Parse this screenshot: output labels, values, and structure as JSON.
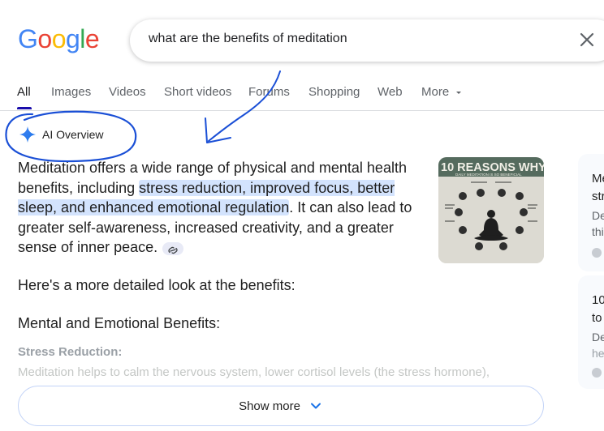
{
  "logo": {
    "letters": [
      "G",
      "o",
      "o",
      "g",
      "l",
      "e"
    ],
    "colors": [
      "#4285F4",
      "#EA4335",
      "#FBBC05",
      "#4285F4",
      "#34A853",
      "#EA4335"
    ]
  },
  "search": {
    "query": "what are the benefits of meditation",
    "clear_icon": "close-icon"
  },
  "tabs": [
    {
      "label": "All",
      "active": true
    },
    {
      "label": "Images"
    },
    {
      "label": "Videos"
    },
    {
      "label": "Short videos"
    },
    {
      "label": "Forums"
    },
    {
      "label": "Shopping"
    },
    {
      "label": "Web"
    },
    {
      "label": "More"
    }
  ],
  "ai_overview": {
    "label": "AI Overview",
    "icon": "sparkle-icon",
    "text_before": "Meditation offers a wide range of physical and mental health benefits, including ",
    "highlight": "stress reduction, improved focus, better sleep, and enhanced emotional regulation",
    "text_after": ". It can also lead to greater self-awareness, increased creativity, and a greater sense of inner peace.",
    "thumbnail_title": "10 REASONS WHY",
    "thumbnail_subtitle": "DAILY MEDITATION IS SO BENEFICIAL",
    "subhead1": "Here's a more detailed look at the benefits:",
    "subhead2": "Mental and Emotional Benefits:",
    "section_title": "Stress Reduction:",
    "section_text": "Meditation helps to calm the nervous system, lower cortisol levels (the stress hormone),",
    "show_more": "Show more"
  },
  "side_cards": [
    {
      "title1": "Me",
      "title2": "str",
      "snip1": "De",
      "snip2": "thi"
    },
    {
      "title1": "10",
      "title2": "to",
      "snip1": "De",
      "snip2": "he"
    }
  ],
  "colors": {
    "accent": "#1a0dab",
    "highlight": "#d3e3fd",
    "annotation": "#1a4fd6"
  }
}
